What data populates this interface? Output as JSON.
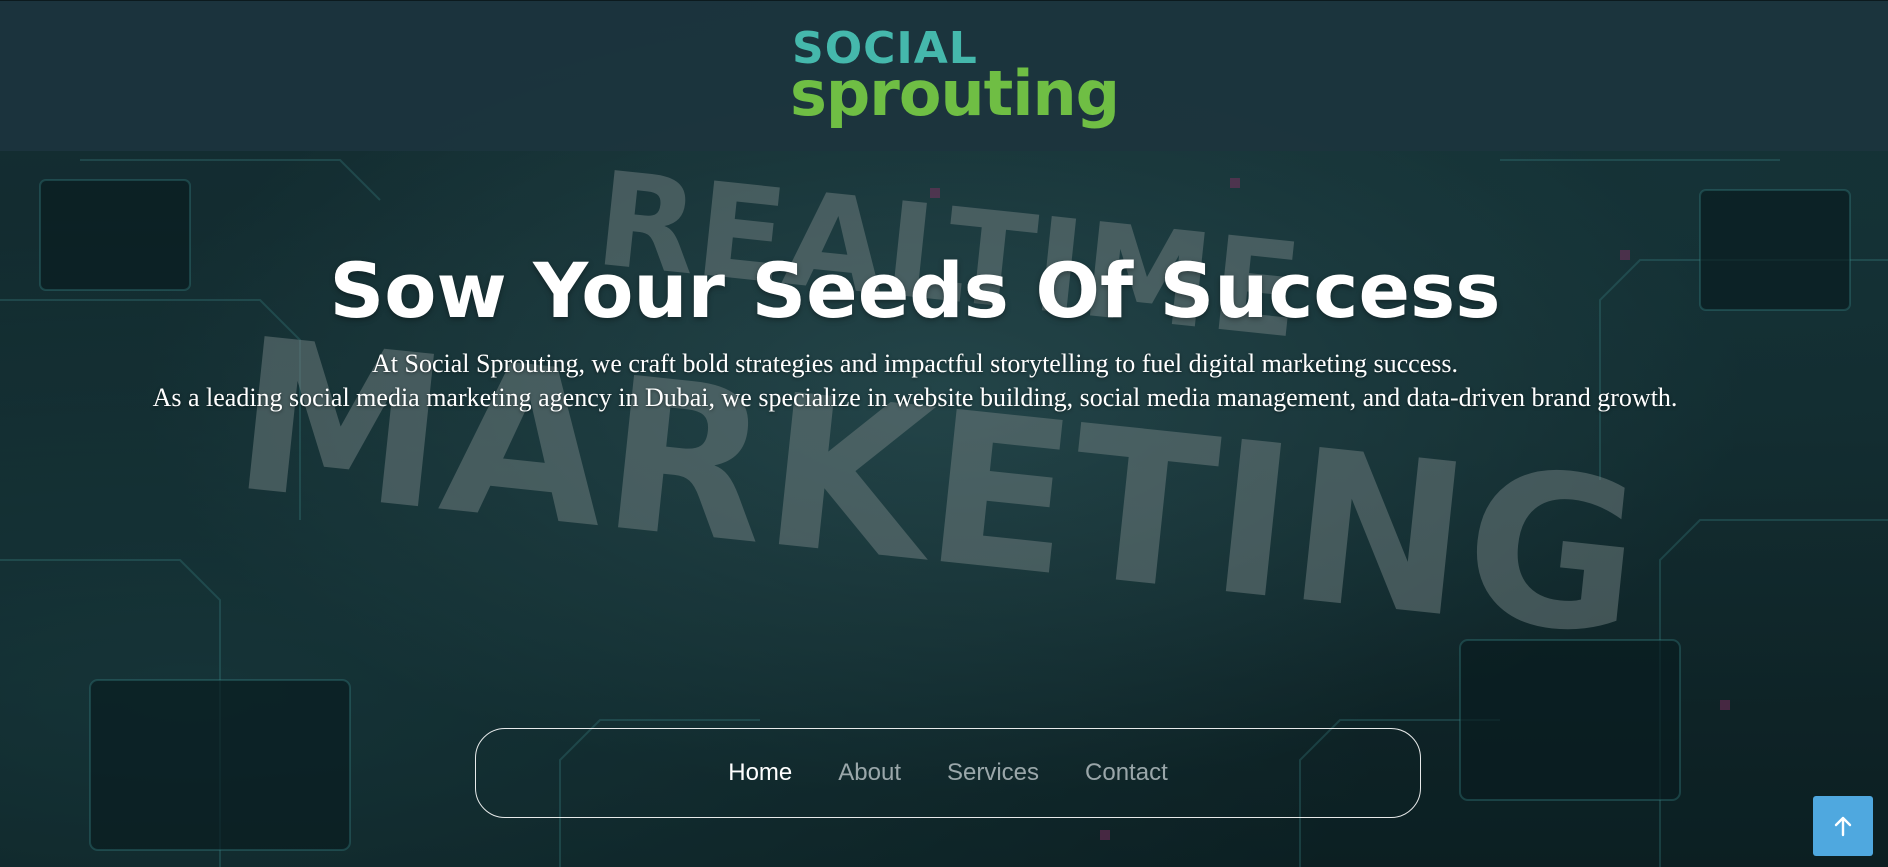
{
  "header": {
    "logo": {
      "line1": "SOCIAL",
      "line2": "sprouting"
    }
  },
  "hero": {
    "background_text": [
      "REALTIME",
      "MARKETING"
    ],
    "headline": "Sow Your Seeds Of Success",
    "subtext_line1": "At Social Sprouting, we craft bold strategies and impactful storytelling to fuel digital marketing success.",
    "subtext_line2": "As a leading social media marketing agency in Dubai, we specialize in website building, social media management, and data-driven brand growth."
  },
  "nav": {
    "items": [
      {
        "label": "Home",
        "active": true
      },
      {
        "label": "About",
        "active": false
      },
      {
        "label": "Services",
        "active": false
      },
      {
        "label": "Contact",
        "active": false
      }
    ]
  },
  "back_to_top": {
    "icon": "arrow-up-icon"
  },
  "colors": {
    "header_bg": "#1c343e",
    "logo_teal": "#45b8ac",
    "logo_green": "#6fbe44",
    "back_to_top": "#4fa8df",
    "text": "#ffffff"
  }
}
